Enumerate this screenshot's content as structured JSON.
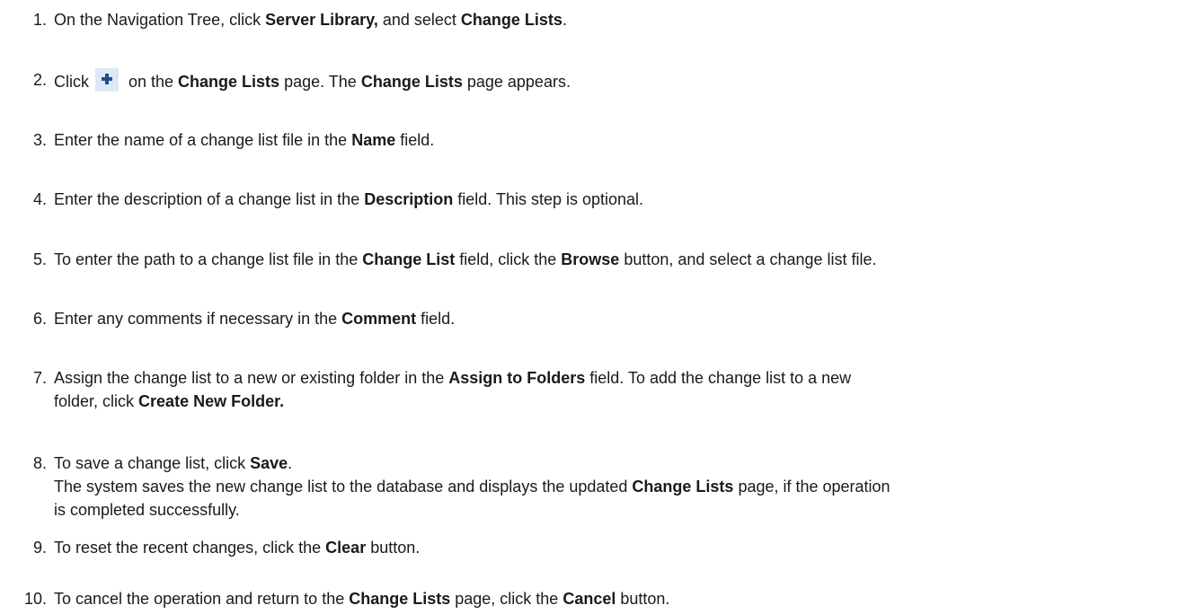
{
  "steps": [
    {
      "num": "1.",
      "parts": [
        "On the Navigation Tree, click ",
        "Server Library,",
        " and select ",
        "Change Lists",
        "."
      ]
    },
    {
      "num": "2.",
      "parts": [
        "Click ",
        " on the ",
        "Change Lists",
        " page. The ",
        "Change Lists",
        " page appears."
      ],
      "icon": "add-plus-icon"
    },
    {
      "num": "3.",
      "parts": [
        "Enter the name of a change list file in the ",
        "Name",
        " field."
      ]
    },
    {
      "num": "4.",
      "parts": [
        "Enter the description of a change list in the ",
        "Description",
        " field. This step is optional."
      ]
    },
    {
      "num": "5.",
      "parts": [
        "To enter the path to a change list file in the ",
        "Change List",
        " field, click the ",
        "Browse",
        " button, and select a change list file."
      ]
    },
    {
      "num": "6.",
      "parts": [
        "Enter any comments if necessary in the ",
        "Comment",
        " field."
      ]
    },
    {
      "num": "7.",
      "parts": [
        "Assign the change list to a new or existing folder in the ",
        "Assign to Folders",
        " field. To add the change list to a new",
        "folder, click ",
        "Create New Folder."
      ]
    },
    {
      "num": "8.",
      "parts": [
        "To save a change list, click ",
        "Save",
        ".",
        "The system saves the new change list to the database and displays the updated ",
        "Change Lists",
        " page, if the operation",
        "is completed successfully."
      ]
    },
    {
      "num": "9.",
      "parts": [
        "To reset the recent changes, click the ",
        "Clear",
        " button."
      ]
    },
    {
      "num": "10.",
      "parts": [
        "To cancel the operation and return to the ",
        "Change Lists",
        " page, click the ",
        "Cancel",
        " button."
      ]
    }
  ]
}
